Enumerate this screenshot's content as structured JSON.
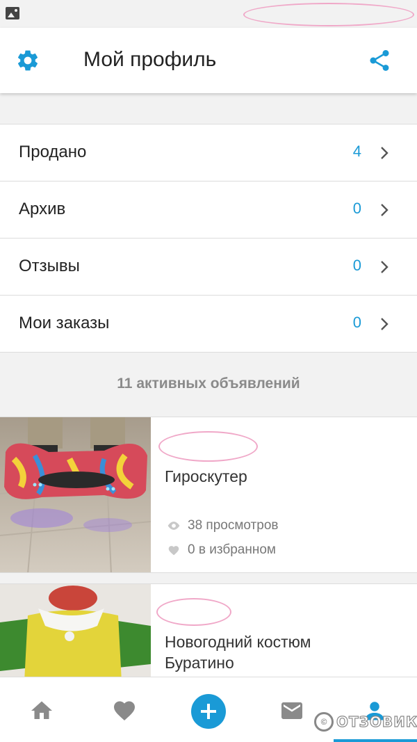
{
  "header": {
    "title": "Мой профиль"
  },
  "menu": [
    {
      "label": "Продано",
      "count": "4"
    },
    {
      "label": "Архив",
      "count": "0"
    },
    {
      "label": "Отзывы",
      "count": "0"
    },
    {
      "label": "Мои заказы",
      "count": "0"
    }
  ],
  "listings": {
    "heading": "11 активных объявлений",
    "items": [
      {
        "title": "Гироскутер",
        "views": "38 просмотров",
        "favorites": "0 в избранном"
      },
      {
        "title_line1": "Новогодний костюм",
        "title_line2": "Буратино"
      }
    ]
  },
  "watermark": {
    "text": "ОТЗОВИК"
  },
  "colors": {
    "accent": "#1a9ad6",
    "title_text": "#222222",
    "muted_text": "#8a8a8a"
  },
  "icons": {
    "header_left": "gear-icon",
    "header_right": "share-icon",
    "nav": [
      "home-icon",
      "heart-icon",
      "plus-icon",
      "mail-icon",
      "person-icon"
    ]
  }
}
